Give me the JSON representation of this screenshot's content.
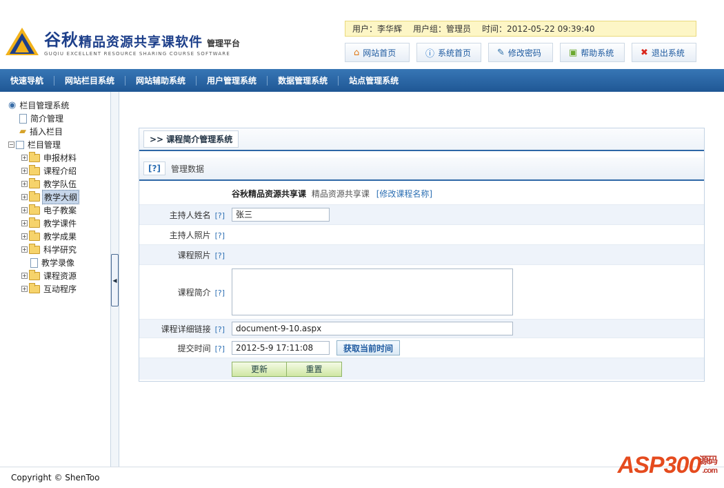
{
  "header": {
    "brand_big": "谷秋",
    "brand_rest": "精品资源共享课软件",
    "brand_sub": "管理平台",
    "brand_en": "GUQIU EXCELLENT RESOURCE SHARING COURSE SOFTWARE",
    "info": {
      "user": "用户：李华辉",
      "group": "用户组：管理员",
      "time": "时间：2012-05-22 09:39:40"
    },
    "buttons": [
      {
        "label": "网站首页",
        "icon": "home-icon"
      },
      {
        "label": "系统首页",
        "icon": "info-icon"
      },
      {
        "label": "修改密码",
        "icon": "pen-icon"
      },
      {
        "label": "帮助系统",
        "icon": "help-icon"
      },
      {
        "label": "退出系统",
        "icon": "close-icon"
      }
    ]
  },
  "nav": [
    "快速导航",
    "网站栏目系统",
    "网站辅助系统",
    "用户管理系统",
    "数据管理系统",
    "站点管理系统"
  ],
  "tree": {
    "root": "栏目管理系统",
    "items": [
      "简介管理",
      "插入栏目",
      "栏目管理"
    ],
    "children": [
      "申报材料",
      "课程介绍",
      "教学队伍",
      "教学大纲",
      "电子教案",
      "教学课件",
      "教学成果",
      "科学研究",
      "教学录像",
      "课程资源",
      "互动程序"
    ],
    "selected": "教学大纲"
  },
  "panel": {
    "title": ">> 课程简介管理系统",
    "sub_q": "[?]",
    "sub_title": "管理数据",
    "course_name": "谷秋精品资源共享课",
    "course_short": "精品资源共享课",
    "edit_name": "[修改课程名称]",
    "help": "[?]",
    "fields": {
      "host_name_label": "主持人姓名",
      "host_name_value": "张三",
      "host_photo_label": "主持人照片",
      "course_photo_label": "课程照片",
      "intro_label": "课程简介",
      "intro_value": "",
      "link_label": "课程详细链接",
      "link_value": "document-9-10.aspx",
      "submit_time_label": "提交时间",
      "submit_time_value": "2012-5-9 17:11:08",
      "get_time_button": "获取当前时间"
    },
    "update_button": "更新",
    "reset_button": "重置"
  },
  "footer": {
    "copyright": "Copyright © ShenToo",
    "watermark": "ASP300",
    "watermark_com": ".com",
    "watermark_cn": "源码"
  },
  "colors": {
    "nav_bg": "#2a67a5",
    "brand": "#1d3f8a",
    "accent": "#2d67a6"
  }
}
